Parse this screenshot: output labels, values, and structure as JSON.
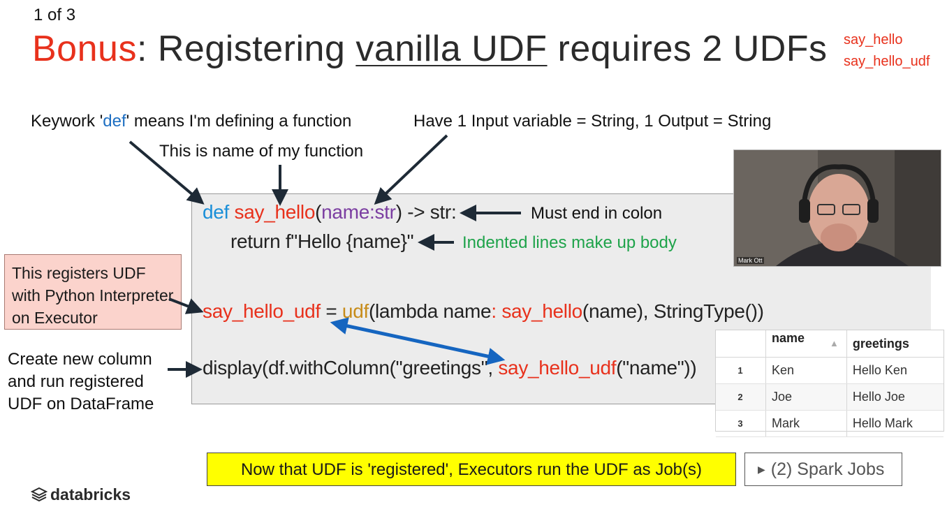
{
  "slide": {
    "number_text": "1 of 3",
    "title_bonus": "Bonus",
    "title_mid": ": Registering ",
    "title_ul": "vanilla UDF",
    "title_end": " requires 2 UDFs",
    "side_names": [
      "say_hello",
      "say_hello_udf"
    ]
  },
  "annotations": {
    "keyword_pre": "Keywork '",
    "keyword_def": "def",
    "keyword_post": "' means I'm defining a function",
    "name_of_function": "This is name of my function",
    "io": "Have 1 Input variable = String, 1 Output = String",
    "must_end": "Must end in colon",
    "indented": "Indented lines make up body",
    "registers_udf": [
      "This registers UDF",
      "with Python Interpreter",
      "on Executor"
    ],
    "create_column": [
      "Create new column",
      "and run registered",
      "UDF on DataFrame"
    ]
  },
  "code": {
    "line1": {
      "def": "def",
      "fname": "say_hello",
      "open": "(",
      "param": "name:str",
      "rest": ") -> str:"
    },
    "line2": {
      "text": "return f\"Hello {name}\""
    },
    "line3": {
      "var": "say_hello_udf",
      "eq": " = ",
      "udf": "udf",
      "mid": "(lambda name",
      "colon": ": ",
      "call": "say_hello",
      "rest": "(name), StringType())"
    },
    "line4": {
      "pre": "display(df.withColumn(\"greetings\", ",
      "call": "say_hello_udf",
      "rest": "(\"name\"))"
    }
  },
  "video": {
    "name": "Mark Ott"
  },
  "result_table": {
    "columns": [
      "name",
      "greetings"
    ],
    "rows": [
      {
        "index": "1",
        "name": "Ken",
        "greeting": "Hello Ken"
      },
      {
        "index": "2",
        "name": "Joe",
        "greeting": "Hello Joe"
      },
      {
        "index": "3",
        "name": "Mark",
        "greeting": "Hello Mark"
      }
    ]
  },
  "banner": "Now that UDF is 'registered', Executors run the UDF as Job(s)",
  "spark_jobs": "(2) Spark Jobs",
  "brand": "databricks",
  "colors": {
    "accent_red": "#e8311c",
    "keyword_blue": "#1a8fd8",
    "highlight": "#ffff00"
  }
}
